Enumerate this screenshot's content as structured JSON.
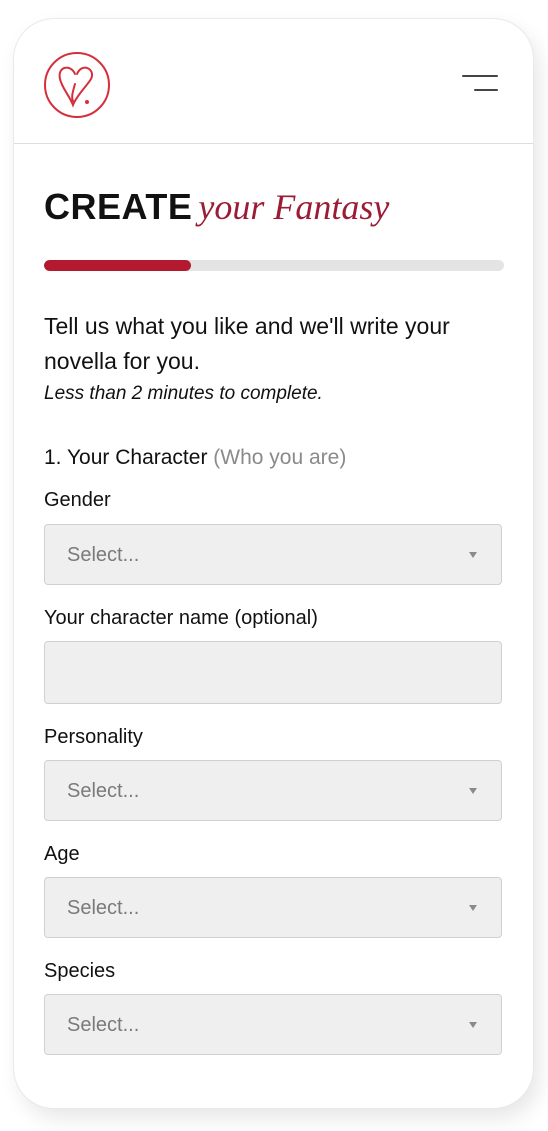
{
  "header": {
    "logo_icon": "heart-logo-icon",
    "menu_icon": "hamburger-menu-icon",
    "brand_color": "#d62f3c"
  },
  "hero": {
    "title_bold": "CREATE",
    "title_italic": "your Fantasy",
    "accent_color": "#9b1c35",
    "progress_fraction": 0.32,
    "progress_color": "#b3192f"
  },
  "intro": {
    "text": "Tell us what you like and we'll write your novella for you.",
    "subtext": "Less than 2 minutes to complete."
  },
  "section": {
    "number_title": "1. Your Character",
    "hint": "(Who you are)"
  },
  "fields": {
    "gender": {
      "label": "Gender",
      "value": "Select..."
    },
    "name": {
      "label": "Your character name (optional)",
      "value": ""
    },
    "personality": {
      "label": "Personality",
      "value": "Select..."
    },
    "age": {
      "label": "Age",
      "value": "Select..."
    },
    "species": {
      "label": "Species",
      "value": "Select..."
    }
  }
}
